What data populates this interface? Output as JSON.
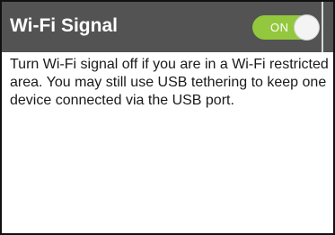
{
  "panel": {
    "title": "Wi-Fi Signal",
    "toggle": {
      "state_label": "ON",
      "is_on": true,
      "accent_color": "#93c83e"
    },
    "description": "Turn Wi-Fi signal off if you are in a Wi-Fi restricted area. You may still use USB tethering to keep one device connected via the USB port."
  },
  "colors": {
    "header_background": "#535353",
    "header_text": "#ffffff",
    "body_background": "#ffffff",
    "body_text": "#1a1a1a"
  }
}
